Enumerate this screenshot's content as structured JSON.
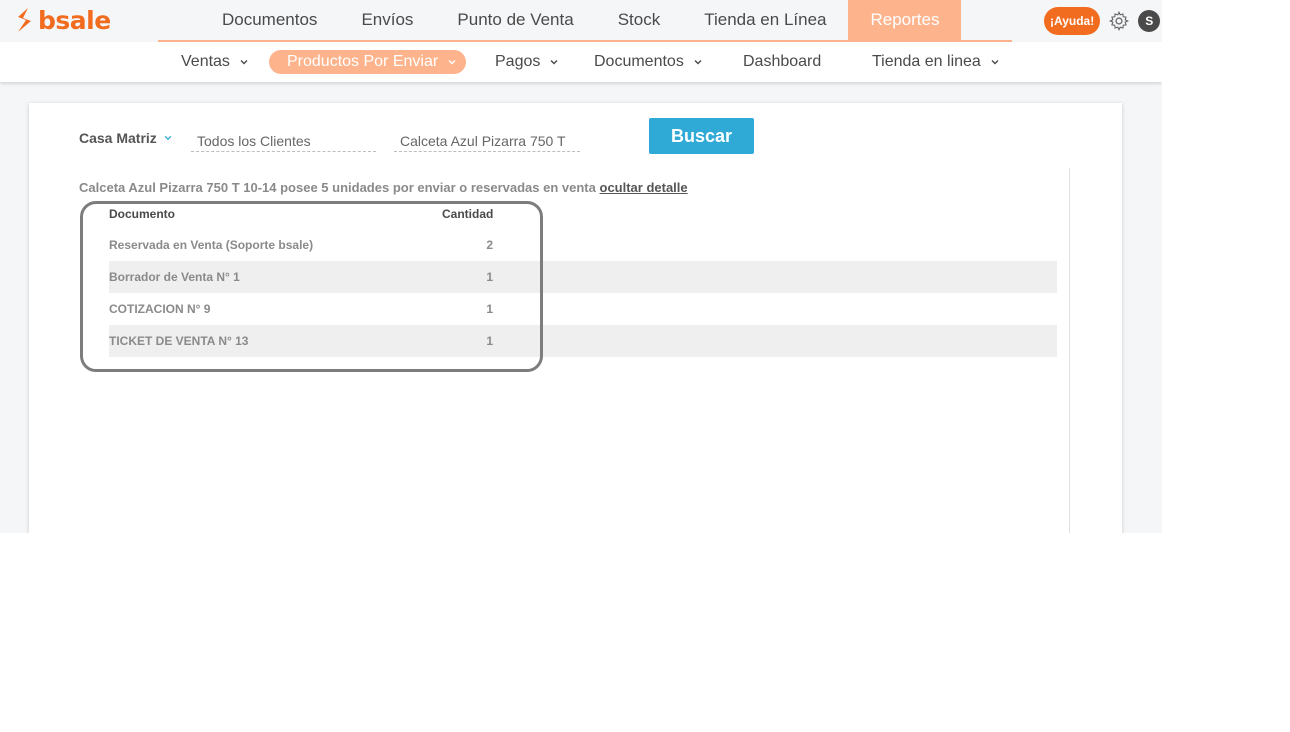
{
  "brand": {
    "name": "bsale",
    "color": "#f26c1f"
  },
  "main_nav": [
    "Documentos",
    "Envíos",
    "Punto de Venta",
    "Stock",
    "Tienda en Línea",
    "Reportes"
  ],
  "main_nav_active": "Reportes",
  "header_tools": {
    "help_label": "¡Ayuda!",
    "avatar_initial": "S"
  },
  "sub_nav": {
    "items": [
      {
        "label": "Ventas",
        "has_dropdown": true
      },
      {
        "label": "Productos Por Enviar",
        "has_dropdown": true,
        "active": true
      },
      {
        "label": "Pagos",
        "has_dropdown": true
      },
      {
        "label": "Documentos",
        "has_dropdown": true
      },
      {
        "label": "Dashboard",
        "has_dropdown": false
      },
      {
        "label": "Tienda en linea",
        "has_dropdown": true
      }
    ]
  },
  "filters": {
    "branch": "Casa Matriz",
    "client_value": "Todos los Clientes",
    "product_value": "Calceta Azul Pizarra 750 T",
    "search_label": "Buscar"
  },
  "summary": {
    "text": "Calceta Azul Pizarra 750 T 10-14 posee 5 unidades por enviar o reservadas en venta",
    "toggle_link": "ocultar detalle"
  },
  "table": {
    "columns": [
      "Documento",
      "Cantidad"
    ],
    "rows": [
      {
        "document": "Reservada en Venta (Soporte bsale)",
        "quantity": "2"
      },
      {
        "document": "Borrador de Venta N° 1",
        "quantity": "1"
      },
      {
        "document": "COTIZACION N° 9",
        "quantity": "1"
      },
      {
        "document": "TICKET DE VENTA N° 13",
        "quantity": "1"
      }
    ]
  },
  "colors": {
    "accent": "#fdb48d",
    "button": "#2fa9d6",
    "orange": "#f26c1f"
  }
}
